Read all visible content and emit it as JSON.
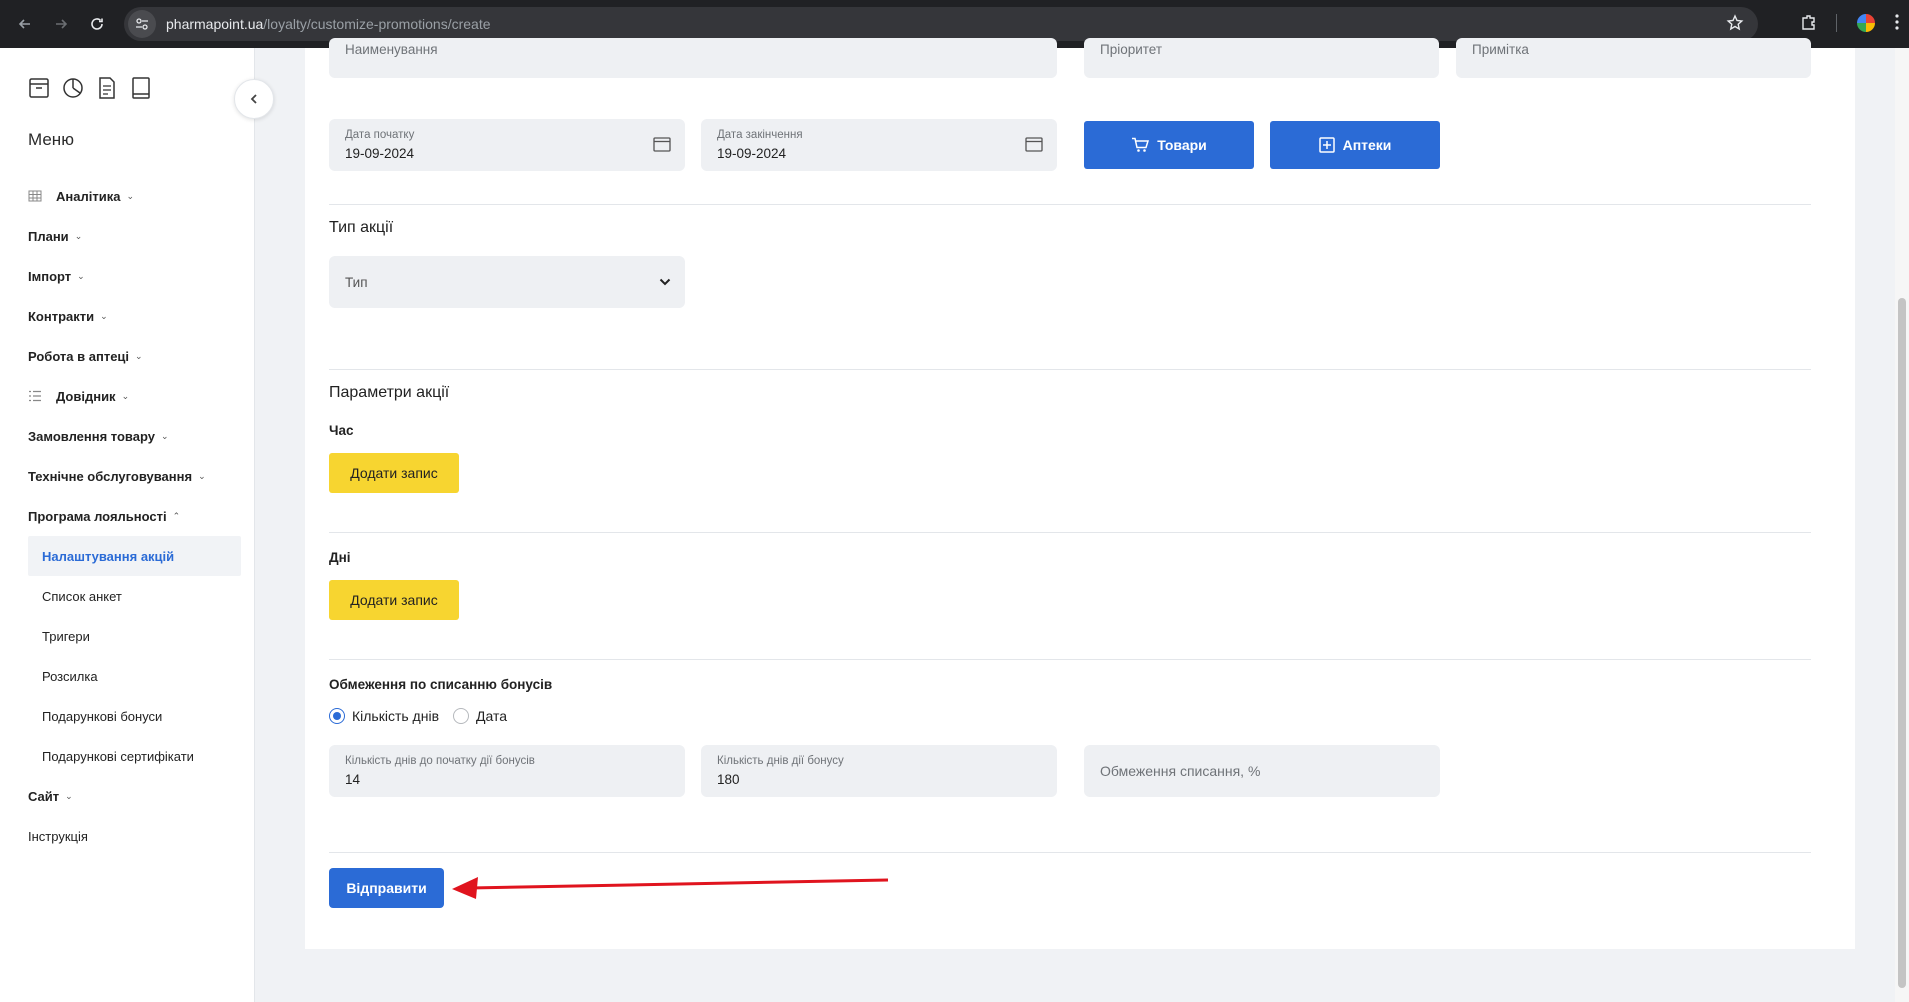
{
  "browser": {
    "url_domain": "pharmapoint.ua",
    "url_path": "/loyalty/customize-promotions/create"
  },
  "sidebar": {
    "menu_title": "Меню",
    "items": [
      {
        "label": "Аналітика",
        "icon": "grid-icon"
      },
      {
        "label": "Плани"
      },
      {
        "label": "Імпорт"
      },
      {
        "label": "Контракти"
      },
      {
        "label": "Робота в аптеці"
      },
      {
        "label": "Довідник",
        "icon": "list-icon"
      },
      {
        "label": "Замовлення товару"
      },
      {
        "label": "Технічне обслуговування"
      },
      {
        "label": "Програма лояльності"
      }
    ],
    "sub_items": [
      {
        "label": "Налаштування акцій",
        "active": true
      },
      {
        "label": "Список анкет"
      },
      {
        "label": "Тригери"
      },
      {
        "label": "Розсилка"
      },
      {
        "label": "Подарункові бонуси"
      },
      {
        "label": "Подарункові сертифікати"
      }
    ],
    "after_items": [
      {
        "label": "Сайт"
      },
      {
        "label": "Інструкція"
      }
    ]
  },
  "form": {
    "name_placeholder": "Наименування",
    "priority_placeholder": "Пріоритет",
    "note_placeholder": "Примітка",
    "start_date": {
      "label": "Дата початку",
      "value": "19-09-2024"
    },
    "end_date": {
      "label": "Дата закінчення",
      "value": "19-09-2024"
    },
    "goods_button": "Товари",
    "pharmacies_button": "Аптеки",
    "promo_type_title": "Тип акції",
    "type_select": "Тип",
    "params_title": "Параметри акції",
    "time_title": "Час",
    "days_title": "Дні",
    "add_record": "Додати запис",
    "bonus_limit_title": "Обмеження по списанню бонусів",
    "radio_days": "Кількість днів",
    "radio_date": "Дата",
    "radio_selected": "Кількість днів",
    "days_before_start": {
      "label": "Кількість днів до початку дії бонусів",
      "value": "14"
    },
    "days_duration": {
      "label": "Кількість днів дії бонусу",
      "value": "180"
    },
    "limit_placeholder": "Обмеження списання, %",
    "submit_button": "Відправити"
  },
  "colors": {
    "primary": "#2b6bd6",
    "accent_yellow": "#f7d530",
    "annotation_arrow": "#e0141e"
  }
}
